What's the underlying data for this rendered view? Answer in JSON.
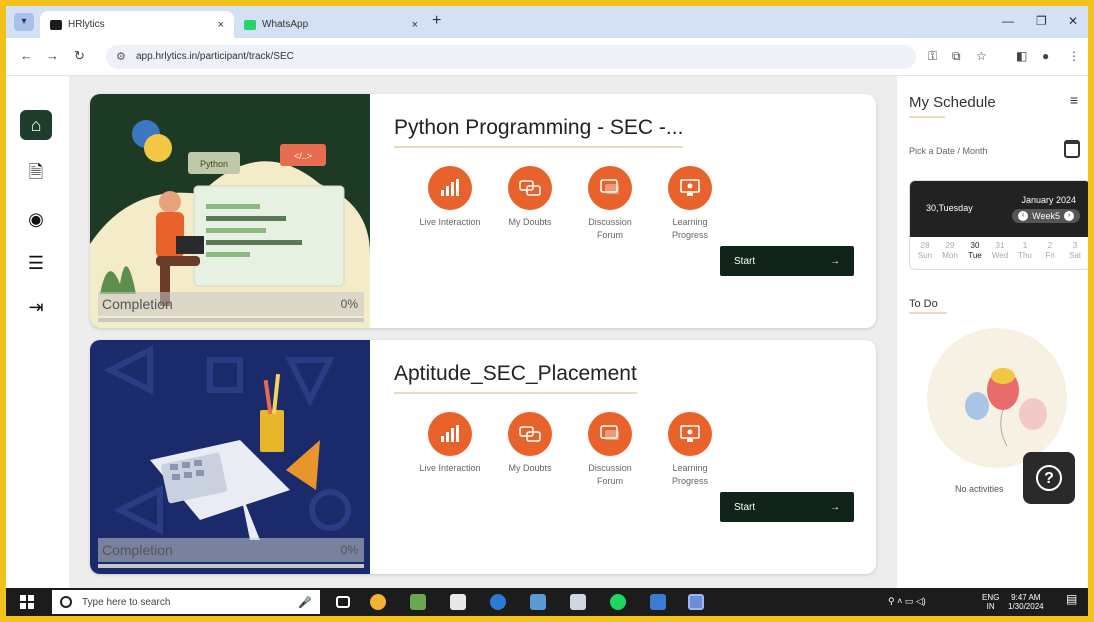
{
  "browser": {
    "tabs": [
      {
        "title": "HRlytics",
        "favicon_color": "#1b1b1b"
      },
      {
        "title": "WhatsApp",
        "favicon_color": "#25d366"
      }
    ],
    "url": "app.hrlytics.in/participant/track/SEC"
  },
  "courses": [
    {
      "title": "Python Programming - SEC -...",
      "completion_label": "Completion",
      "completion_pct": "0%",
      "art_label_python": "Python",
      "art_label_code": "</..>",
      "start_label": "Start",
      "start_arrow": "→"
    },
    {
      "title": "Aptitude_SEC_Placement",
      "completion_label": "Completion",
      "completion_pct": "0%",
      "start_label": "Start",
      "start_arrow": "→"
    }
  ],
  "actions": [
    {
      "label": "Live Interaction",
      "icon": "bar-chart-icon"
    },
    {
      "label": "My Doubts",
      "icon": "chat-doubts-icon"
    },
    {
      "label": "Discussion Forum",
      "icon": "forum-icon"
    },
    {
      "label": "Learning Progress",
      "icon": "progress-monitor-icon"
    }
  ],
  "schedule": {
    "title": "My Schedule",
    "pick_label": "Pick a Date / Month",
    "selected_day": "30,Tuesday",
    "month": "January 2024",
    "week": "Week5",
    "days": [
      {
        "num": "28",
        "name": "Sun"
      },
      {
        "num": "29",
        "name": "Mon"
      },
      {
        "num": "30",
        "name": "Tue"
      },
      {
        "num": "31",
        "name": "Wed"
      },
      {
        "num": "1",
        "name": "Thu"
      },
      {
        "num": "2",
        "name": "Fri"
      },
      {
        "num": "3",
        "name": "Sat"
      }
    ],
    "todo_title": "To Do",
    "no_activities": "No activities",
    "help": "?"
  },
  "taskbar": {
    "search_placeholder": "Type here to search",
    "lang_top": "ENG",
    "lang_bottom": "IN",
    "time": "9:47 AM",
    "date": "1/30/2024"
  },
  "colors": {
    "accent_orange": "#e8632b",
    "dark_green": "#10241a",
    "frame_yellow": "#f3c21a"
  }
}
